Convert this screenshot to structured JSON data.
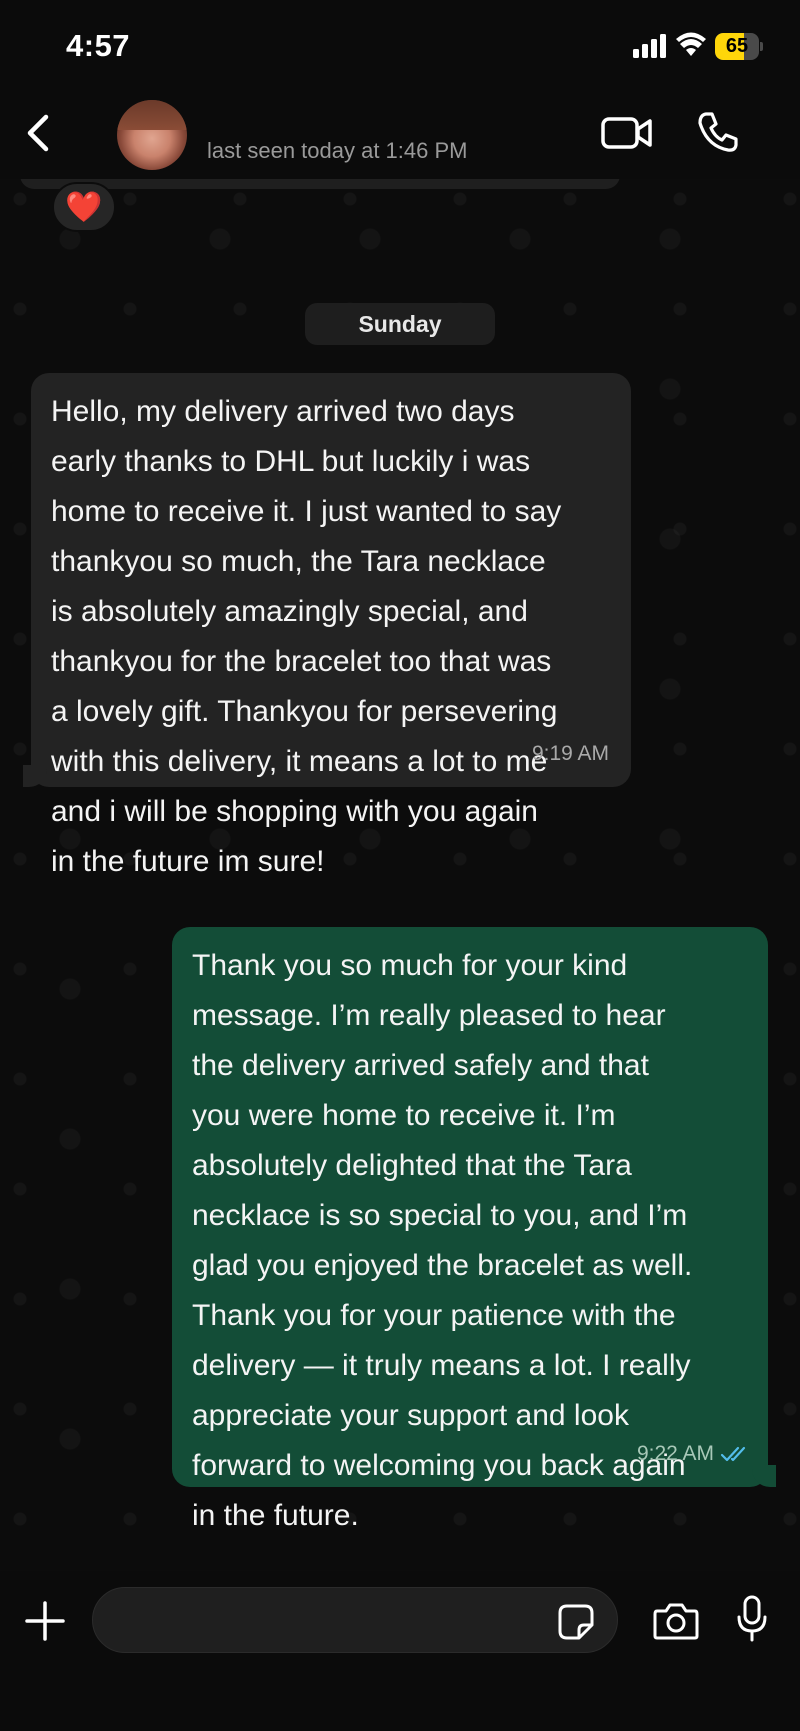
{
  "status_bar": {
    "time": "4:57",
    "battery_level": "65",
    "battery_fraction": 0.65,
    "battery_color": "#ffd60a",
    "icons": [
      "signal-icon",
      "wifi-icon",
      "battery-icon"
    ]
  },
  "header": {
    "last_seen": "last seen today at 1:46 PM",
    "icons": [
      "back-icon",
      "avatar",
      "video-call-icon",
      "phone-call-icon"
    ]
  },
  "chat": {
    "reaction": "❤️",
    "date_separator": "Sunday",
    "messages": [
      {
        "direction": "incoming",
        "text": "Hello, my delivery arrived two days\nearly thanks to DHL but luckily i was\nhome to receive it. I just wanted to say\nthankyou so much, the Tara necklace\nis absolutely amazingly special, and\nthankyou for the bracelet too that was\na lovely gift. Thankyou for persevering\nwith this delivery, it means a lot to me\nand i will be shopping with you again\nin the future im sure!",
        "time": "9:19 AM"
      },
      {
        "direction": "outgoing",
        "text": "Thank you so much for your kind\nmessage. I’m really pleased to hear\nthe delivery arrived safely and that\nyou were home to receive it. I’m\nabsolutely delighted that the Tara\nnecklace is so special to you, and I’m\nglad you enjoyed the bracelet as well.\nThank you for your patience with the\ndelivery — it truly means a lot. I really\nappreciate your support and look\nforward to welcoming you back again\nin the future.",
        "time": "9:22 AM",
        "status": "read"
      }
    ]
  },
  "input_bar": {
    "icons": [
      "plus-icon",
      "sticker-icon",
      "camera-icon",
      "microphone-icon"
    ]
  },
  "colors": {
    "incoming_bubble": "#232323",
    "outgoing_bubble": "#134d37",
    "read_ticks": "#53bdeb"
  }
}
